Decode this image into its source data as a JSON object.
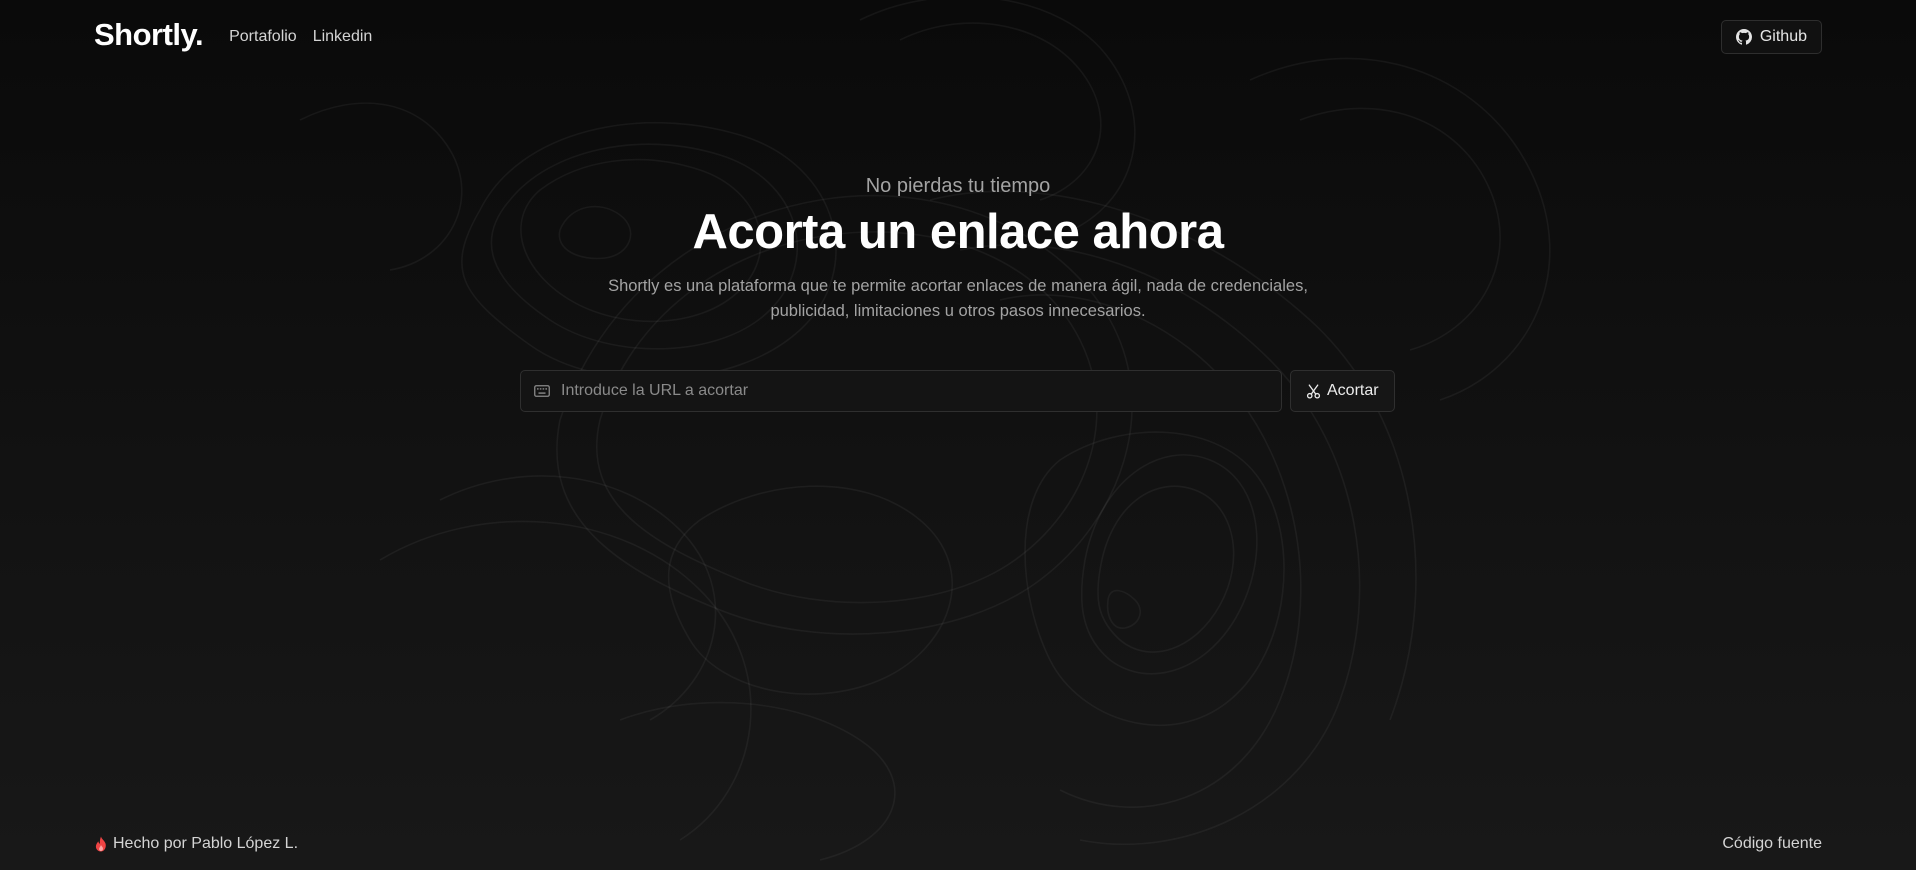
{
  "header": {
    "logo": "Shortly.",
    "nav": [
      {
        "label": "Portafolio"
      },
      {
        "label": "Linkedin"
      }
    ],
    "github_label": "Github",
    "github_icon": "github-icon"
  },
  "hero": {
    "eyebrow": "No pierdas tu tiempo",
    "title": "Acorta un enlace ahora",
    "description": "Shortly es una plataforma que te permite acortar enlaces de manera ágil, nada de credenciales, publicidad, limitaciones u otros pasos innecesarios."
  },
  "form": {
    "input_icon": "keyboard-icon",
    "placeholder": "Introduce la URL a acortar",
    "value": "",
    "button_icon": "scissors-icon",
    "button_label": "Acortar"
  },
  "footer": {
    "icon": "fire-icon",
    "credit": "Hecho por Pablo López L.",
    "source_label": "Código fuente"
  },
  "colors": {
    "background": "#0b0b0b",
    "text": "#ffffff",
    "muted": "#a3a3a3",
    "border": "#2f2f2f",
    "fire": "#ef4444"
  }
}
